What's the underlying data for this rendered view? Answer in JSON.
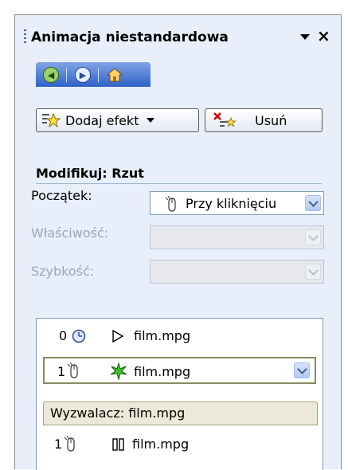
{
  "panel": {
    "title": "Animacja niestandardowa"
  },
  "toolbar": {
    "add_effect_label": "Dodaj efekt",
    "remove_label": "Usuń"
  },
  "section": {
    "title": "Modifikuj: Rzut"
  },
  "fields": [
    {
      "label": "Początek:",
      "value": "Przy kliknięciu",
      "enabled": true
    },
    {
      "label": "Właściwość:",
      "value": "",
      "enabled": false
    },
    {
      "label": "Szybkość:",
      "value": "",
      "enabled": false
    }
  ],
  "list": {
    "items": [
      {
        "number": "0",
        "file": "film.mpg",
        "trigger_icon": "clock-icon",
        "effect_icon": "play-triangle-icon",
        "selected": false
      },
      {
        "number": "1",
        "file": "film.mpg",
        "trigger_icon": "mouse-click-icon",
        "effect_icon": "green-star-icon",
        "selected": true
      }
    ],
    "trigger_header": "Wyzwalacz: film.mpg",
    "trigger_items": [
      {
        "number": "1",
        "file": "film.mpg",
        "trigger_icon": "mouse-click-icon",
        "effect_icon": "pause-icon"
      }
    ]
  },
  "colors": {
    "panel_bg": "#e8eefa",
    "nav_blue": "#2f62c7",
    "trigger_bg": "#ece9d8"
  }
}
